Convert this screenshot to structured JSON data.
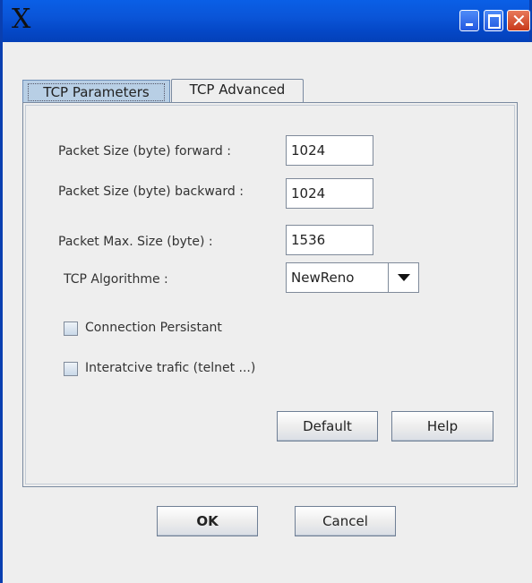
{
  "window": {
    "title_glyph": "X",
    "close_glyph": "✕"
  },
  "tabs": [
    {
      "label": "TCP Parameters",
      "active": true
    },
    {
      "label": "TCP Advanced",
      "active": false
    }
  ],
  "form": {
    "packet_forward": {
      "label": "Packet Size (byte) forward  :",
      "value": "1024"
    },
    "packet_backward": {
      "label": "Packet Size (byte) backward :",
      "value": "1024"
    },
    "packet_max": {
      "label": "Packet Max. Size (byte)  :",
      "value": "1536"
    },
    "algorithm": {
      "label": "TCP Algorithme  :",
      "value": "NewReno"
    },
    "persistent": {
      "label": "Connection Persistant",
      "checked": false
    },
    "interactive": {
      "label": "Interatcive trafic (telnet ...)",
      "checked": false
    }
  },
  "panel_buttons": {
    "default_label": "Default",
    "help_label": "Help"
  },
  "dialog_buttons": {
    "ok_label": "OK",
    "cancel_label": "Cancel"
  },
  "colors": {
    "titlebar": "#0a55d8",
    "active_tab": "#b8cfe5",
    "frame_bg": "#eeeeee"
  }
}
